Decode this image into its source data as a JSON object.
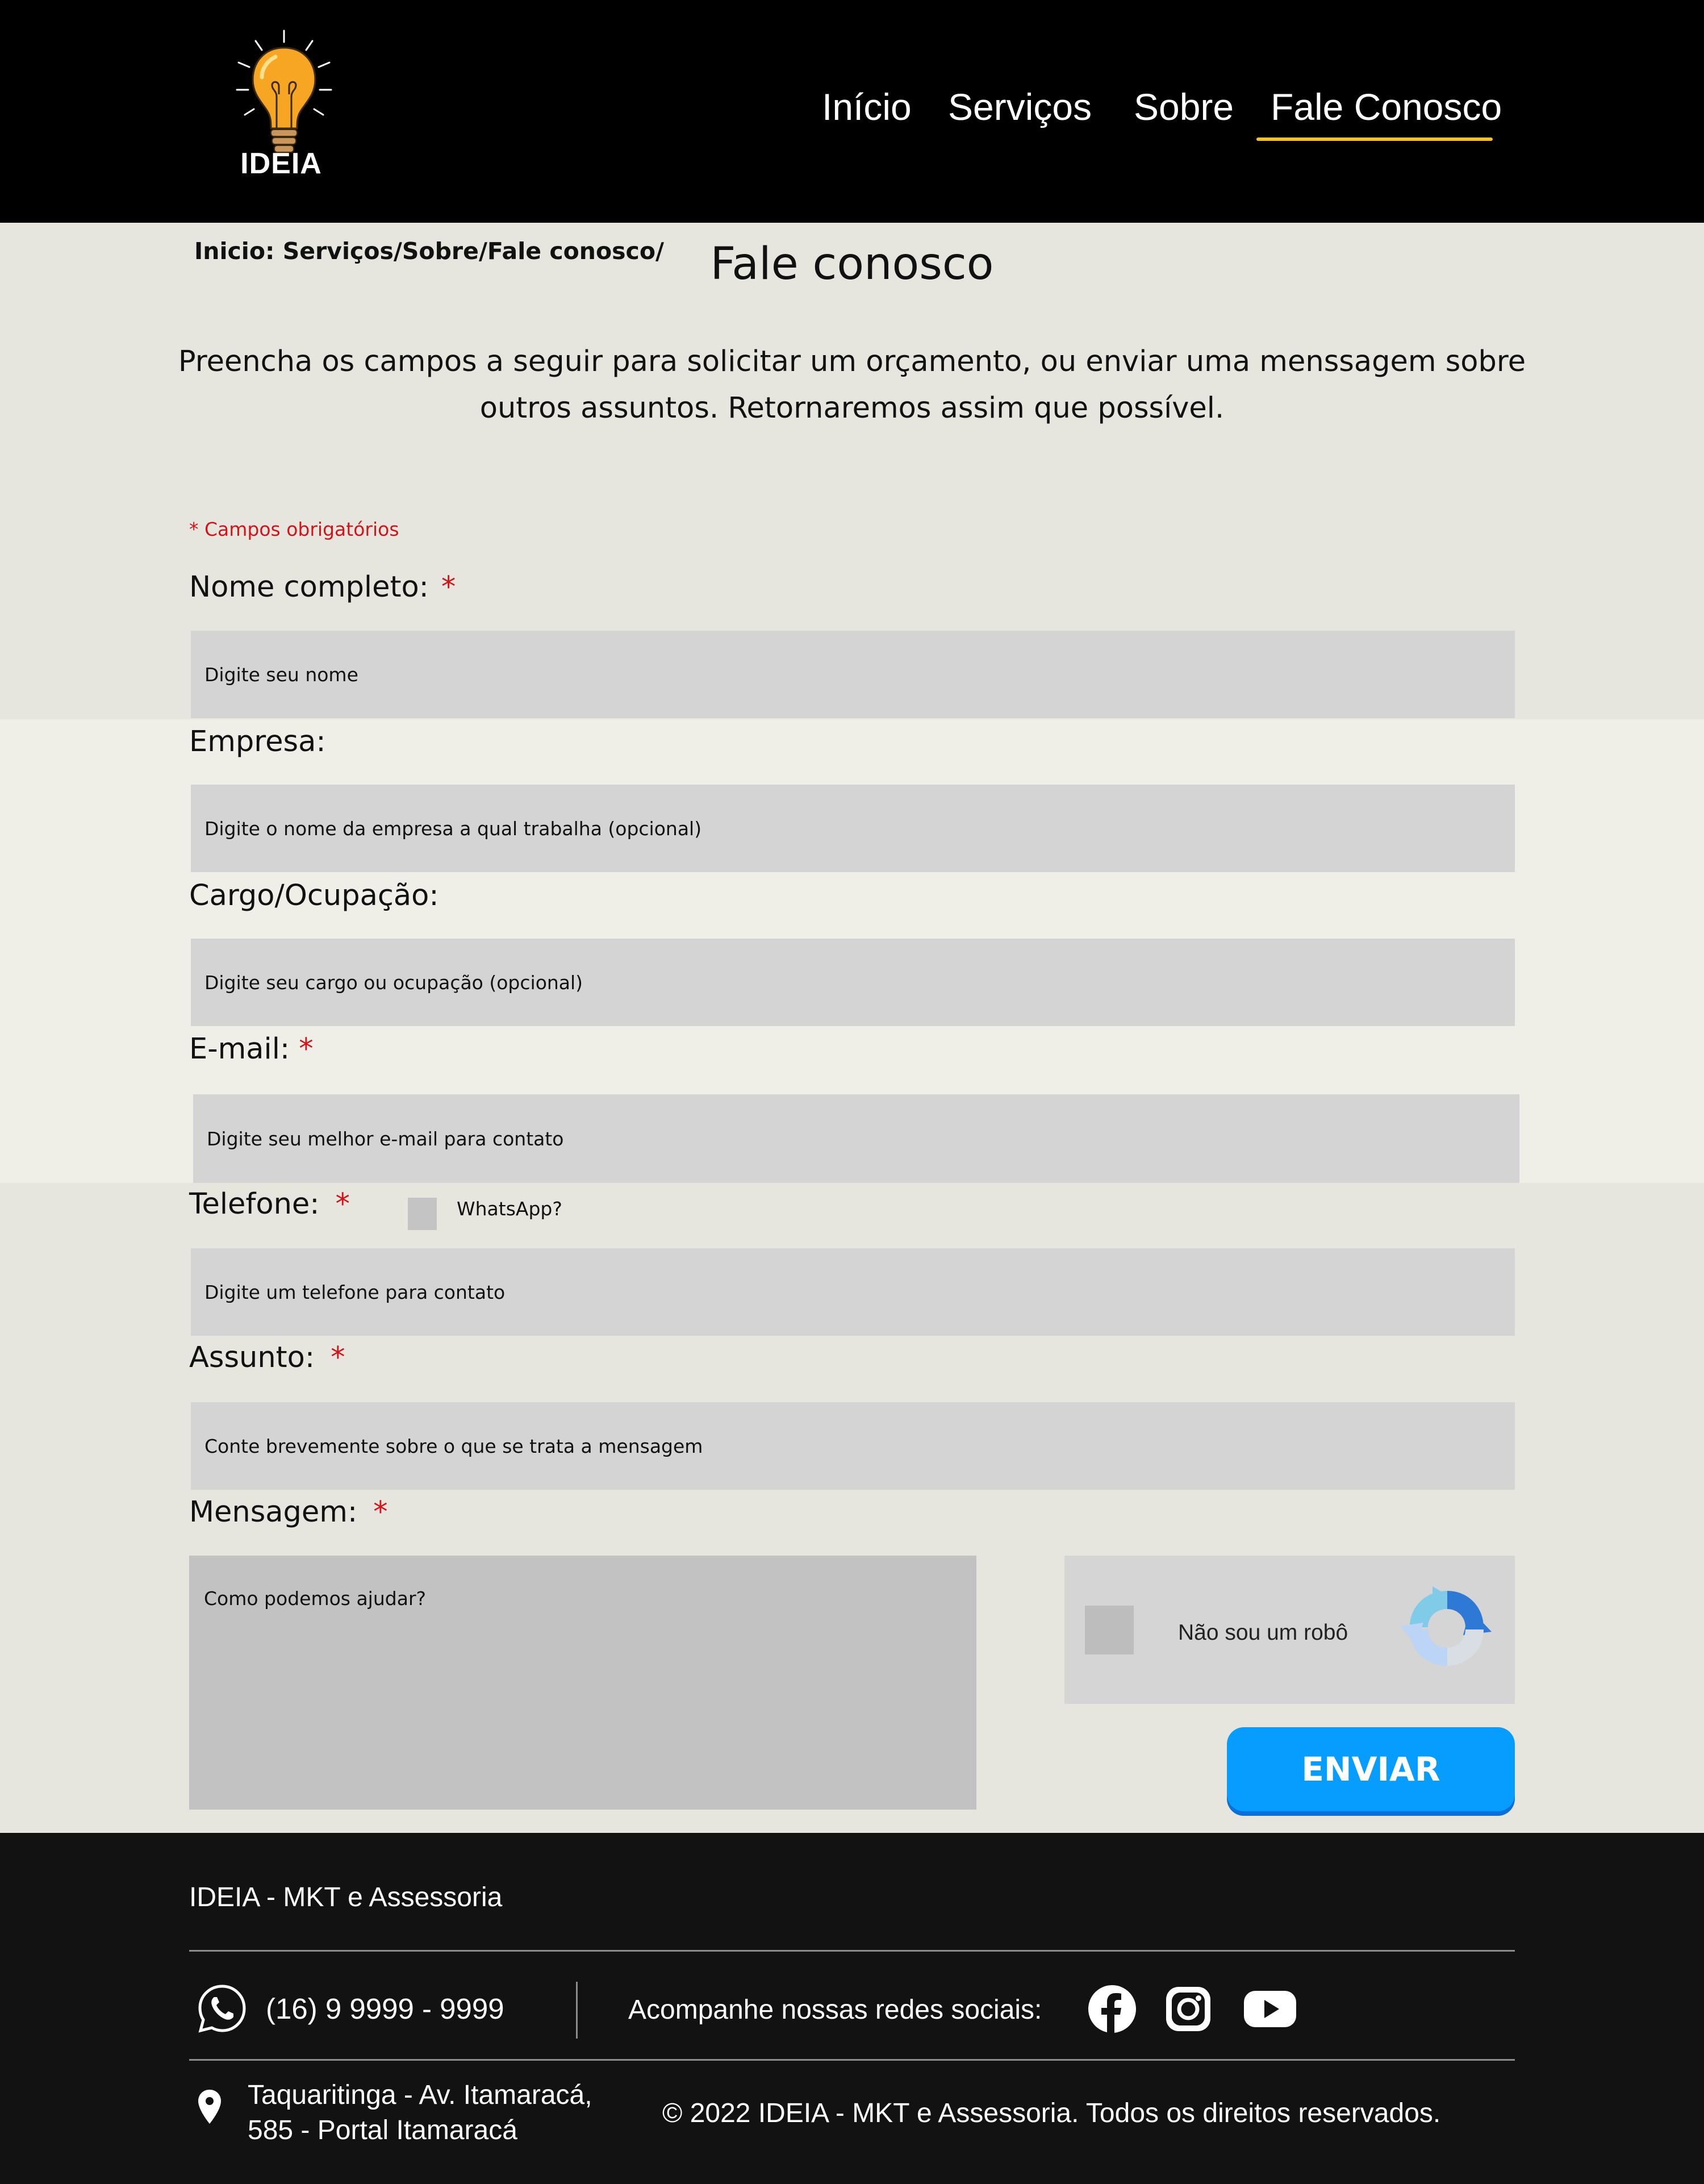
{
  "header": {
    "logo_text": "IDEIA",
    "nav": [
      "Início",
      "Serviços",
      "Sobre",
      "Fale Conosco"
    ],
    "active_nav": "Fale Conosco",
    "accent_color": "#f2c12e"
  },
  "breadcrumb": "Inicio: Serviços/Sobre/Fale conosco/",
  "page_title": "Fale conosco",
  "intro": "Preencha os campos a seguir para solicitar um orçamento, ou enviar uma menssagem sobre outros assuntos. Retornaremos assim que possível.",
  "form": {
    "required_note": "* Campos obrigatórios",
    "required_mark": "*",
    "fields": {
      "name": {
        "label": "Nome completo:",
        "placeholder": "Digite seu nome",
        "required": true
      },
      "company": {
        "label": "Empresa:",
        "placeholder": "Digite o nome da empresa a qual trabalha (opcional)",
        "required": false
      },
      "role": {
        "label": "Cargo/Ocupação:",
        "placeholder": "Digite seu cargo ou ocupação (opcional)",
        "required": false
      },
      "email": {
        "label": "E-mail:",
        "placeholder": "Digite seu melhor e-mail para contato",
        "required": true
      },
      "phone": {
        "label": "Telefone:",
        "placeholder": "Digite um telefone para contato",
        "required": true,
        "whatsapp_label": "WhatsApp?"
      },
      "subject": {
        "label": "Assunto:",
        "placeholder": "Conte brevemente sobre o que se trata a mensagem",
        "required": true
      },
      "message": {
        "label": "Mensagem:",
        "placeholder": "Como podemos ajudar?",
        "required": true
      }
    },
    "captcha_label": "Não sou um robô",
    "submit_label": "ENVIAR",
    "submit_color": "#069dff"
  },
  "footer": {
    "brand": "IDEIA - MKT e Assessoria",
    "phone": "(16) 9 9999 - 9999",
    "social_label": "Acompanhe nossas redes sociais:",
    "social_icons": [
      "facebook-icon",
      "instagram-icon",
      "youtube-icon"
    ],
    "address_line1": "Taquaritinga - Av. Itamaracá,",
    "address_line2": "585 - Portal Itamaracá",
    "copyright": "© 2022 IDEIA - MKT e Assessoria. Todos os direitos reservados."
  }
}
